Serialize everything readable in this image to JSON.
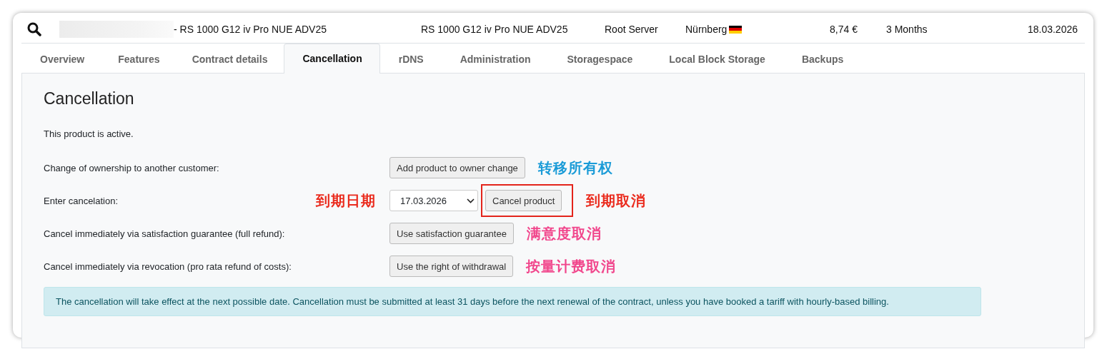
{
  "header": {
    "name": "- RS 1000 G12 iv Pro NUE ADV25",
    "product": "RS 1000 G12 iv Pro NUE ADV25",
    "type": "Root Server",
    "location": "Nürnberg",
    "price": "8,74 €",
    "period": "3 Months",
    "date": "18.03.2026"
  },
  "tabs": [
    {
      "label": "Overview",
      "selected": false
    },
    {
      "label": "Features",
      "selected": false
    },
    {
      "label": "Contract details",
      "selected": false
    },
    {
      "label": "Cancellation",
      "selected": true
    },
    {
      "label": "rDNS",
      "selected": false
    },
    {
      "label": "Administration",
      "selected": false
    },
    {
      "label": "Storagespace",
      "selected": false
    },
    {
      "label": "Local Block Storage",
      "selected": false
    },
    {
      "label": "Backups",
      "selected": false
    }
  ],
  "panel": {
    "title": "Cancellation",
    "status": "This product is active.",
    "rows": [
      {
        "kind": "button",
        "label": "Change of ownership to another customer:",
        "button": "Add product to owner change",
        "note": {
          "text": "转移所有权",
          "color": "#1a9bd7"
        }
      },
      {
        "kind": "date",
        "label": "Enter cancelation:",
        "date": "17.03.2026",
        "button": "Cancel product",
        "highlighted": true,
        "note_before": {
          "text": "到期日期",
          "color": "#ea2a1c"
        },
        "note": {
          "text": "到期取消",
          "color": "#ea2a1c"
        }
      },
      {
        "kind": "button",
        "label": "Cancel immediately via satisfaction guarantee (full refund):",
        "button": "Use satisfaction guarantee",
        "note": {
          "text": "满意度取消",
          "color": "#f1468c"
        }
      },
      {
        "kind": "button",
        "label": "Cancel immediately via revocation (pro rata refund of costs):",
        "button": "Use the right of withdrawal",
        "note": {
          "text": "按量计费取消",
          "color": "#f1468c"
        }
      }
    ],
    "notice": "The cancellation will take effect at the next possible date. Cancellation must be submitted at least 31 days before the next renewal of the contract, unless you have booked a tariff with hourly-based billing."
  }
}
